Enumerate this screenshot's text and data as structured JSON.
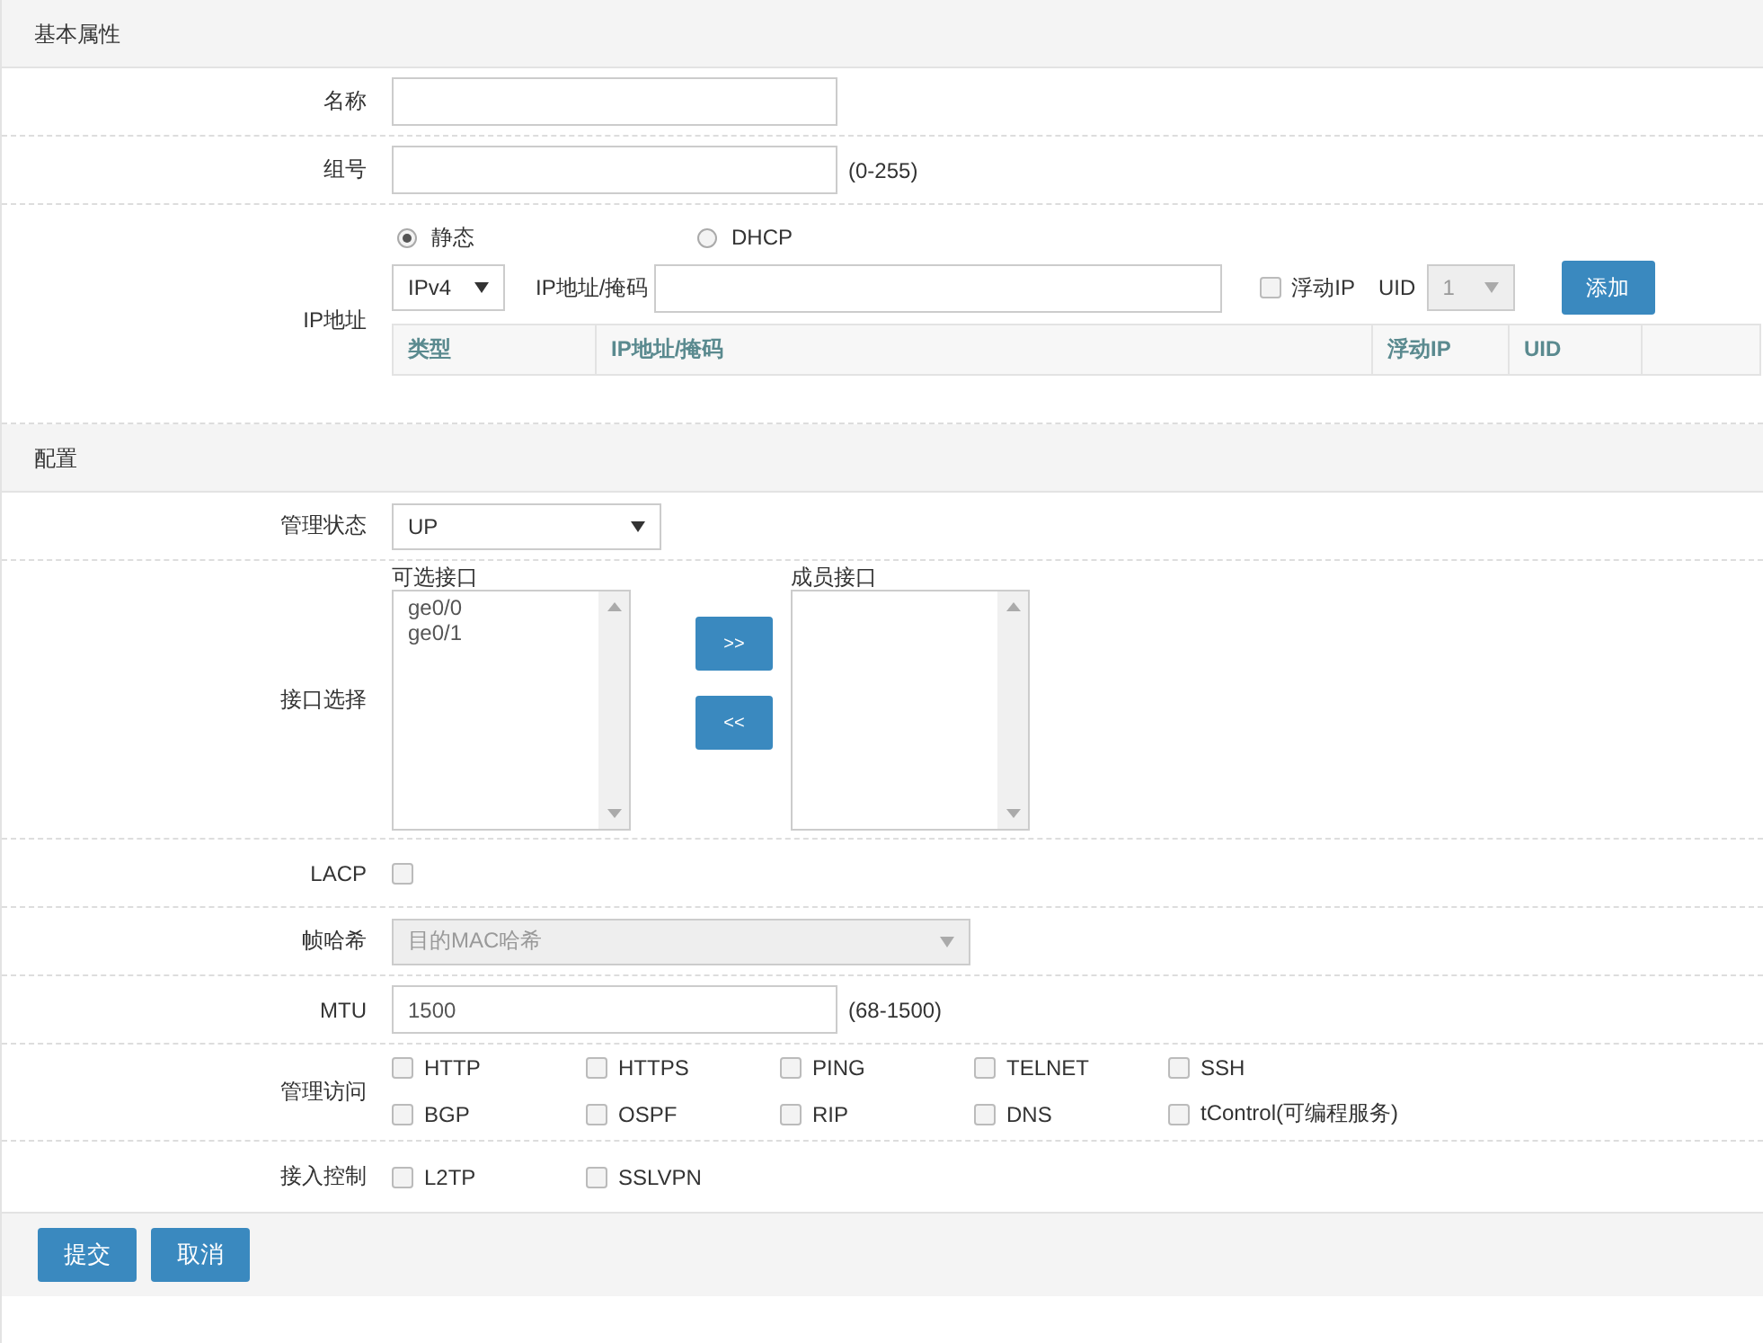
{
  "sections": [
    {
      "title": "基本属性",
      "rows": [
        {
          "kind": "text",
          "label": "名称",
          "value": ""
        },
        {
          "kind": "text",
          "label": "组号",
          "value": "",
          "hint": "(0-255)"
        },
        {
          "kind": "ip",
          "label": "IP地址",
          "modes": [
            {
              "label": "静态",
              "selected": true
            },
            {
              "label": "DHCP",
              "selected": false
            }
          ],
          "family": "IPv4",
          "addr_label": "IP地址/掩码",
          "floating": {
            "label": "浮动IP",
            "checked": false
          },
          "uid": {
            "label": "UID",
            "value": "1",
            "disabled": true
          },
          "add_button": "添加",
          "columns": [
            "类型",
            "IP地址/掩码",
            "浮动IP",
            "UID",
            ""
          ]
        }
      ]
    },
    {
      "title": "配置",
      "rows": [
        {
          "kind": "select",
          "label": "管理状态",
          "value": "UP",
          "disabled": false
        },
        {
          "kind": "transfer",
          "label": "接口选择",
          "available_title": "可选接口",
          "available": [
            "ge0/0",
            "ge0/1"
          ],
          "member_title": "成员接口",
          "members": [],
          "add": ">>",
          "remove": "<<"
        },
        {
          "kind": "checkbox",
          "label": "LACP",
          "checked": false
        },
        {
          "kind": "select",
          "label": "帧哈希",
          "value": "目的MAC哈希",
          "disabled": true
        },
        {
          "kind": "text",
          "label": "MTU",
          "value": "1500",
          "hint": "(68-1500)"
        },
        {
          "kind": "checks",
          "label": "管理访问",
          "options": [
            {
              "label": "HTTP",
              "checked": false
            },
            {
              "label": "HTTPS",
              "checked": false
            },
            {
              "label": "PING",
              "checked": false
            },
            {
              "label": "TELNET",
              "checked": false
            },
            {
              "label": "SSH",
              "checked": false
            },
            {
              "label": "BGP",
              "checked": false
            },
            {
              "label": "OSPF",
              "checked": false
            },
            {
              "label": "RIP",
              "checked": false
            },
            {
              "label": "DNS",
              "checked": false
            },
            {
              "label": "tControl(可编程服务)",
              "checked": false
            }
          ]
        },
        {
          "kind": "checks",
          "label": "接入控制",
          "options": [
            {
              "label": "L2TP",
              "checked": false
            },
            {
              "label": "SSLVPN",
              "checked": false
            }
          ]
        }
      ]
    }
  ],
  "footer": [
    "提交",
    "取消"
  ]
}
